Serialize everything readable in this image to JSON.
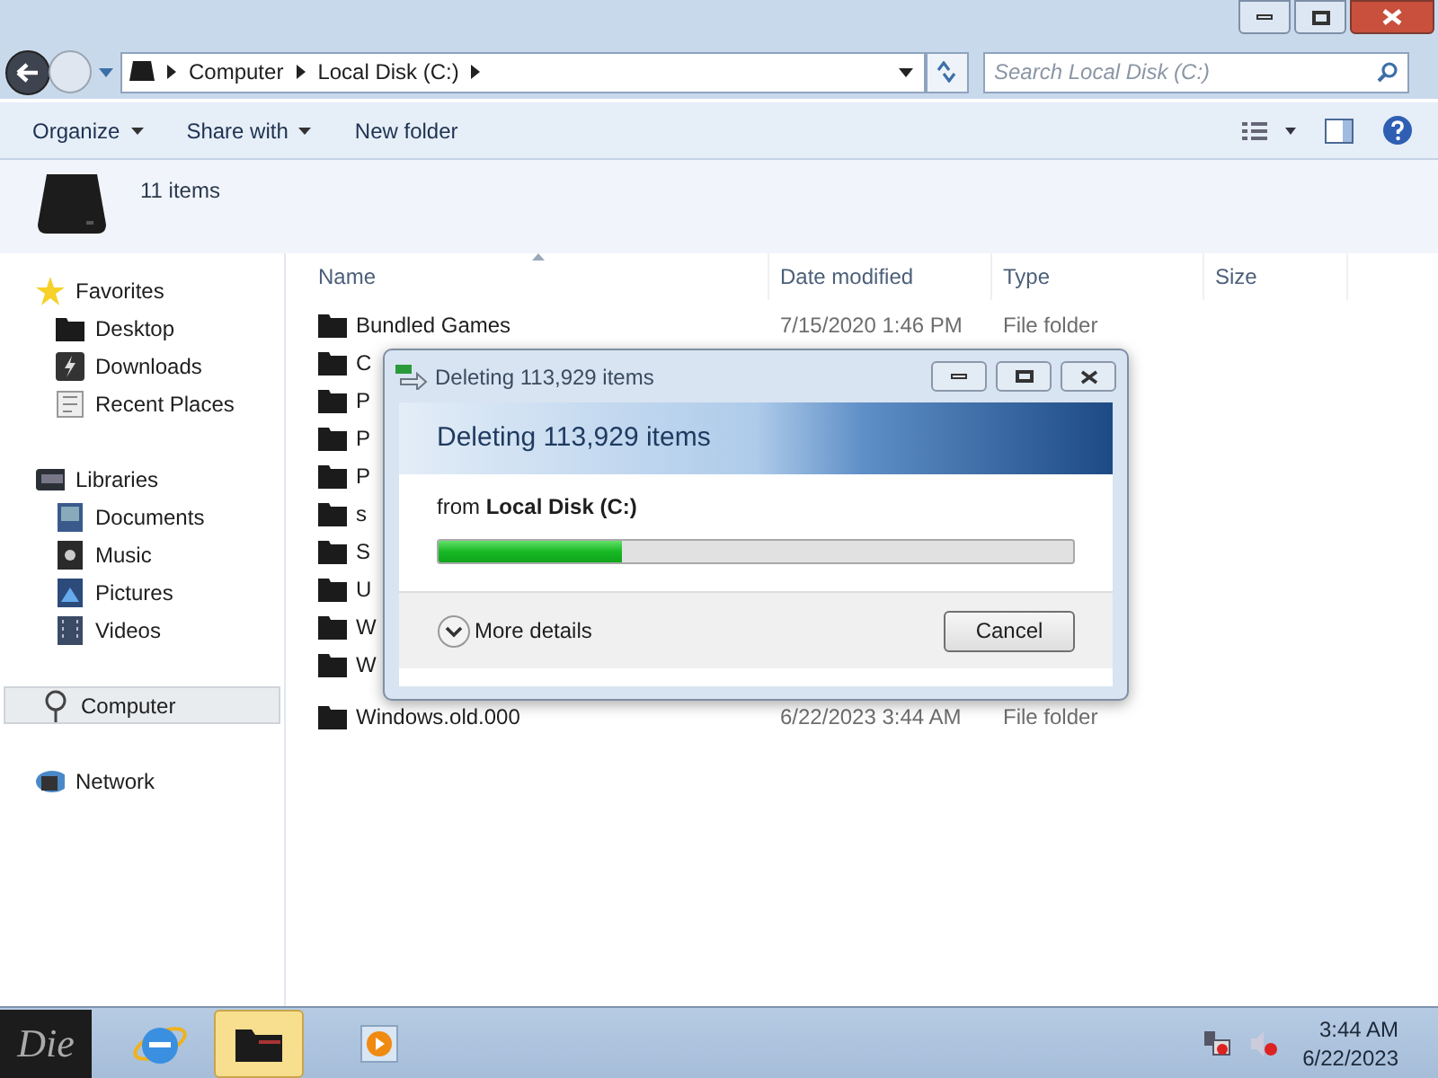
{
  "address_bar": {
    "crumbs": [
      "Computer",
      "Local Disk (C:)"
    ]
  },
  "search": {
    "placeholder": "Search Local Disk (C:)"
  },
  "toolbar": {
    "items": [
      {
        "label": "Organize",
        "menu": true
      },
      {
        "label": "Share with",
        "menu": true
      },
      {
        "label": "New folder",
        "menu": false
      }
    ]
  },
  "details_pane": {
    "summary": "11 items"
  },
  "sidebar": {
    "groups": [
      {
        "label": "Favorites",
        "selected": false,
        "children": [
          {
            "label": "Desktop"
          },
          {
            "label": "Downloads"
          },
          {
            "label": "Recent Places"
          }
        ]
      },
      {
        "label": "Libraries",
        "selected": false,
        "children": [
          {
            "label": "Documents"
          },
          {
            "label": "Music"
          },
          {
            "label": "Pictures"
          },
          {
            "label": "Videos"
          }
        ]
      },
      {
        "label": "Computer",
        "selected": true
      },
      {
        "label": "Network",
        "selected": false
      }
    ]
  },
  "file_list": {
    "columns": [
      "Name",
      "Date modified",
      "Type",
      "Size"
    ],
    "rows": [
      {
        "name": "Bundled Games",
        "date": "7/15/2020 1:46 PM",
        "type": "File folder"
      },
      {
        "name": "C"
      },
      {
        "name": "P"
      },
      {
        "name": "P"
      },
      {
        "name": "P"
      },
      {
        "name": "s"
      },
      {
        "name": "S"
      },
      {
        "name": "U"
      },
      {
        "name": "W"
      },
      {
        "name": "W"
      },
      {
        "name": "Windows.old.000",
        "date": "6/22/2023 3:44 AM",
        "type": "File folder"
      }
    ]
  },
  "dialog": {
    "title": "Deleting 113,929 items",
    "heading": "Deleting 113,929 items",
    "from": "from **Local Disk (C:)**",
    "level": 0.29,
    "more_details": "More details",
    "cancel": "Cancel"
  },
  "taskbar": {
    "start": "Die",
    "time": "3:44 AM",
    "date": "6/22/2023"
  }
}
